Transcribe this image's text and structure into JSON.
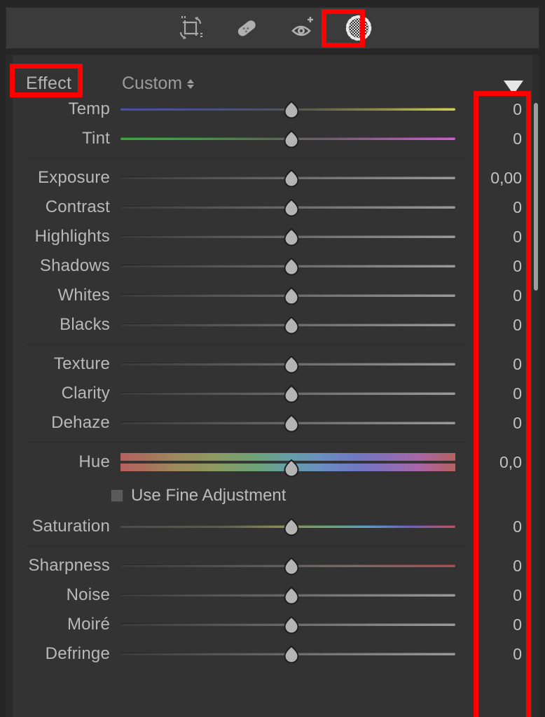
{
  "toolbar": {
    "tools": [
      {
        "name": "crop-overlay-tool",
        "icon": "crop-rotate-icon",
        "label": "Crop Overlay",
        "active": false
      },
      {
        "name": "healing-tool",
        "icon": "bandage-heal-icon",
        "label": "Healing",
        "active": false
      },
      {
        "name": "red-eye-tool",
        "icon": "red-eye-icon",
        "label": "Red Eye Correction",
        "active": false
      },
      {
        "name": "masking-tool",
        "icon": "mask-dotted-circle-icon",
        "label": "Masking",
        "active": true
      }
    ]
  },
  "panel": {
    "effect_label": "Effect :",
    "effect_value": "Custom",
    "collapse_icon": "triangle-down-icon",
    "checkbox": {
      "label": "Use Fine Adjustment",
      "checked": false
    },
    "groups": [
      {
        "name": "white-balance",
        "sliders": [
          {
            "label": "Temp",
            "value": "0",
            "track": "temp"
          },
          {
            "label": "Tint",
            "value": "0",
            "track": "tint"
          }
        ]
      },
      {
        "name": "tone",
        "sliders": [
          {
            "label": "Exposure",
            "value": "0,00",
            "track": "plain"
          },
          {
            "label": "Contrast",
            "value": "0",
            "track": "plain"
          },
          {
            "label": "Highlights",
            "value": "0",
            "track": "plain"
          },
          {
            "label": "Shadows",
            "value": "0",
            "track": "plain"
          },
          {
            "label": "Whites",
            "value": "0",
            "track": "plain"
          },
          {
            "label": "Blacks",
            "value": "0",
            "track": "plain"
          }
        ]
      },
      {
        "name": "presence",
        "sliders": [
          {
            "label": "Texture",
            "value": "0",
            "track": "plain"
          },
          {
            "label": "Clarity",
            "value": "0",
            "track": "plain"
          },
          {
            "label": "Dehaze",
            "value": "0",
            "track": "plain"
          }
        ]
      },
      {
        "name": "color",
        "sliders": [
          {
            "label": "Hue",
            "value": "0,0",
            "track": "hue"
          },
          {
            "label": "Saturation",
            "value": "0",
            "track": "sat"
          }
        ]
      },
      {
        "name": "detail",
        "sliders": [
          {
            "label": "Sharpness",
            "value": "0",
            "track": "sharp"
          },
          {
            "label": "Noise",
            "value": "0",
            "track": "plain"
          },
          {
            "label": "Moiré",
            "value": "0",
            "track": "plain"
          },
          {
            "label": "Defringe",
            "value": "0",
            "track": "plain"
          }
        ]
      }
    ]
  },
  "annotations": {
    "accent_color": "#ff0000",
    "boxes": [
      {
        "name": "masking-tool-highlight"
      },
      {
        "name": "effect-label-highlight"
      },
      {
        "name": "slider-values-highlight"
      }
    ]
  },
  "colors": {
    "panel_bg": "#333333",
    "toolbar_bg": "#3b3b3b",
    "window_bg": "#262626",
    "text": "#b9b9b9",
    "accent": "#ff0000"
  },
  "scrollbar": {
    "name": "panel-scrollbar",
    "visible": true
  }
}
